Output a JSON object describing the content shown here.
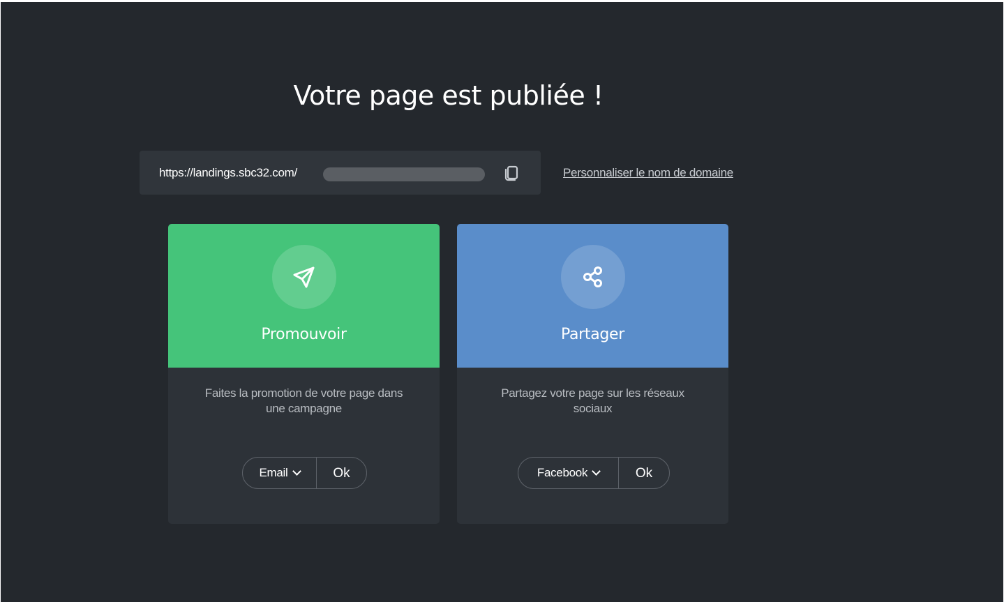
{
  "colors": {
    "background": "#24282d",
    "promote_accent": "#45c47a",
    "share_accent": "#5a8dca"
  },
  "header": {
    "title": "Votre page est publiée !"
  },
  "url_bar": {
    "url_prefix": "https://landings.sbc32.com/",
    "copy_icon": "copy-icon"
  },
  "domain_link": "Personnaliser le nom de domaine",
  "cards": {
    "promote": {
      "icon": "send-icon",
      "title": "Promouvoir",
      "description": "Faites la promotion de votre page dans une campagne",
      "selected_channel": "Email",
      "ok_label": "Ok"
    },
    "share": {
      "icon": "share-icon",
      "title": "Partager",
      "description": "Partagez votre page sur les réseaux sociaux",
      "selected_network": "Facebook",
      "ok_label": "Ok"
    }
  }
}
